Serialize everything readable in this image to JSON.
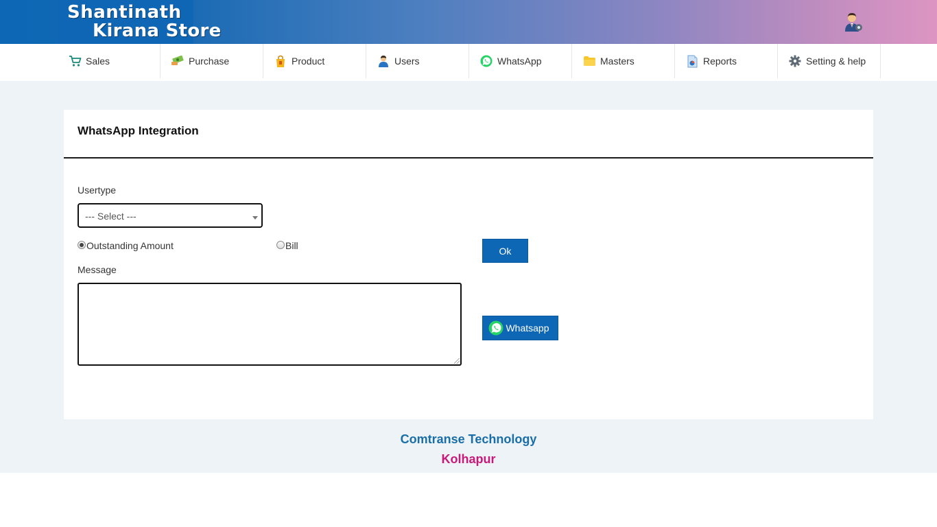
{
  "brand": {
    "line1": "Shantinath",
    "line2": "Kirana Store"
  },
  "nav": {
    "items": [
      {
        "label": "Sales",
        "icon": "cart-icon"
      },
      {
        "label": "Purchase",
        "icon": "money-icon"
      },
      {
        "label": "Product",
        "icon": "product-bag-icon"
      },
      {
        "label": "Users",
        "icon": "user-icon"
      },
      {
        "label": "WhatsApp",
        "icon": "whatsapp-icon"
      },
      {
        "label": "Masters",
        "icon": "folder-icon"
      },
      {
        "label": "Reports",
        "icon": "report-file-icon"
      },
      {
        "label": "Setting & help",
        "icon": "gear-icon"
      }
    ]
  },
  "page": {
    "title": "WhatsApp Integration",
    "usertype_label": "Usertype",
    "usertype_selected": "--- Select ---",
    "radio_outstanding": "Outstanding Amount",
    "radio_bill": "Bill",
    "radio_selected": "Outstanding Amount",
    "message_label": "Message",
    "message_value": "",
    "ok_label": "Ok",
    "whatsapp_button_label": "Whatsapp"
  },
  "footer": {
    "company": "Comtranse Technology",
    "city": "Kolhapur"
  },
  "colors": {
    "primary": "#0e67b4",
    "footer_company": "#1a6ea8",
    "footer_city": "#c8187a",
    "whatsapp_green": "#25d366"
  }
}
